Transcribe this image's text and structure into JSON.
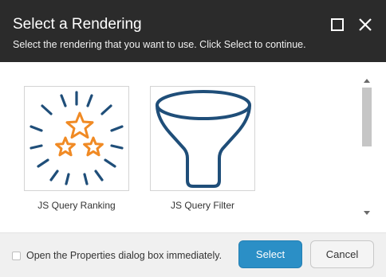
{
  "dialog": {
    "title": "Select a Rendering",
    "subtitle": "Select the rendering that you want to use. Click Select to continue.",
    "controls": {
      "maximize_icon": "maximize-icon",
      "close_icon": "close-icon"
    }
  },
  "renderings": [
    {
      "label": "JS Query Ranking",
      "icon": "stars-burst-icon"
    },
    {
      "label": "JS Query Filter",
      "icon": "funnel-icon"
    }
  ],
  "footer": {
    "checkbox_label": "Open the Properties dialog box immediately.",
    "checkbox_checked": false,
    "select_label": "Select",
    "cancel_label": "Cancel"
  },
  "colors": {
    "header_bg": "#2b2b2b",
    "icon_blue": "#1f4e79",
    "star_orange": "#f08a24",
    "primary_button": "#2b8fc6"
  }
}
